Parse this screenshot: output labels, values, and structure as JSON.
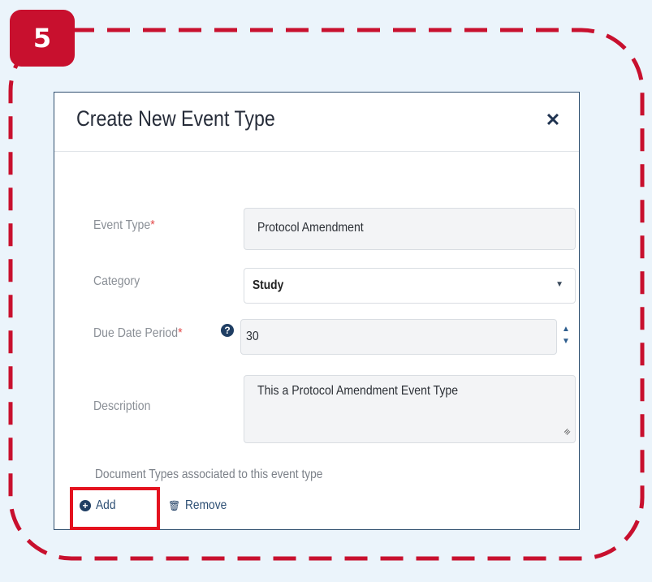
{
  "step": {
    "number": "5"
  },
  "colors": {
    "accent_red": "#c8102e",
    "navy": "#1f3e63",
    "background": "#ebf4fb"
  },
  "modal": {
    "title": "Create New Event Type",
    "close_icon": "times-icon",
    "fields": {
      "event_type": {
        "label": "Event Type",
        "required_mark": "*",
        "value": "Protocol Amendment"
      },
      "category": {
        "label": "Category",
        "value": "Study"
      },
      "due_date_period": {
        "label": "Due Date Period",
        "required_mark": "*",
        "help_icon": "question-circle-icon",
        "value": "30"
      },
      "description": {
        "label": "Description",
        "value": "This a Protocol Amendment Event Type"
      }
    },
    "document_types": {
      "label": "Document Types associated to this event type",
      "add_label": "Add",
      "remove_label": "Remove"
    }
  }
}
